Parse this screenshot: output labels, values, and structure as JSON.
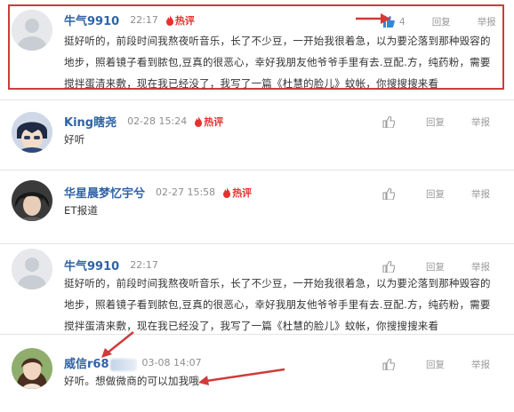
{
  "colors": {
    "username": "#2f63a6",
    "hot_badge": "#e3322f",
    "highlight_box": "#d23a3a",
    "like_active": "#3a86d6"
  },
  "hot_label": "热评",
  "reply_label": "回复",
  "report_label": "举报",
  "comments": [
    {
      "username": "牛气9910",
      "time": "22:17",
      "hot": true,
      "likes": "4",
      "text": "挺好听的，前段时间我熬夜听音乐，长了不少豆，一开始我很着急，以为要沦落到那种毁容的地步，照着镜子看到脓包,豆真的很恶心，幸好我朋友他爷爷手里有去.豆配.方，纯药粉，需要搅拌蛋清来敷，现在我已经没了，我写了一篇《杜慧的脸儿》蚊帐，你搜搜搜来看",
      "avatar": "default-avatar"
    },
    {
      "username": "King瞎尧",
      "time": "02-28 15:24",
      "hot": true,
      "likes": "",
      "text": "好听",
      "avatar": "anime-avatar"
    },
    {
      "username": "华星晨梦忆宇兮",
      "time": "02-27 15:58",
      "hot": true,
      "likes": "",
      "text": "ET报道",
      "avatar": "photo-avatar"
    },
    {
      "username": "牛气9910",
      "time": "22:17",
      "hot": false,
      "likes": "",
      "text": "挺好听的，前段时间我熬夜听音乐，长了不少豆，一开始我很着急，以为要沦落到那种毁容的地步，照着镜子看到脓包,豆真的很恶心，幸好我朋友他爷爷手里有去.豆配.方，纯药粉，需要搅拌蛋清来敷，现在我已经没了，我写了一篇《杜慧的脸儿》蚊帐，你搜搜搜来看",
      "avatar": "default-avatar"
    },
    {
      "username": "威信r68",
      "time": "03-08 14:07",
      "hot": false,
      "likes": "",
      "text": "好听。想做微商的可以加我哦",
      "avatar": "girl-photo-avatar"
    }
  ]
}
